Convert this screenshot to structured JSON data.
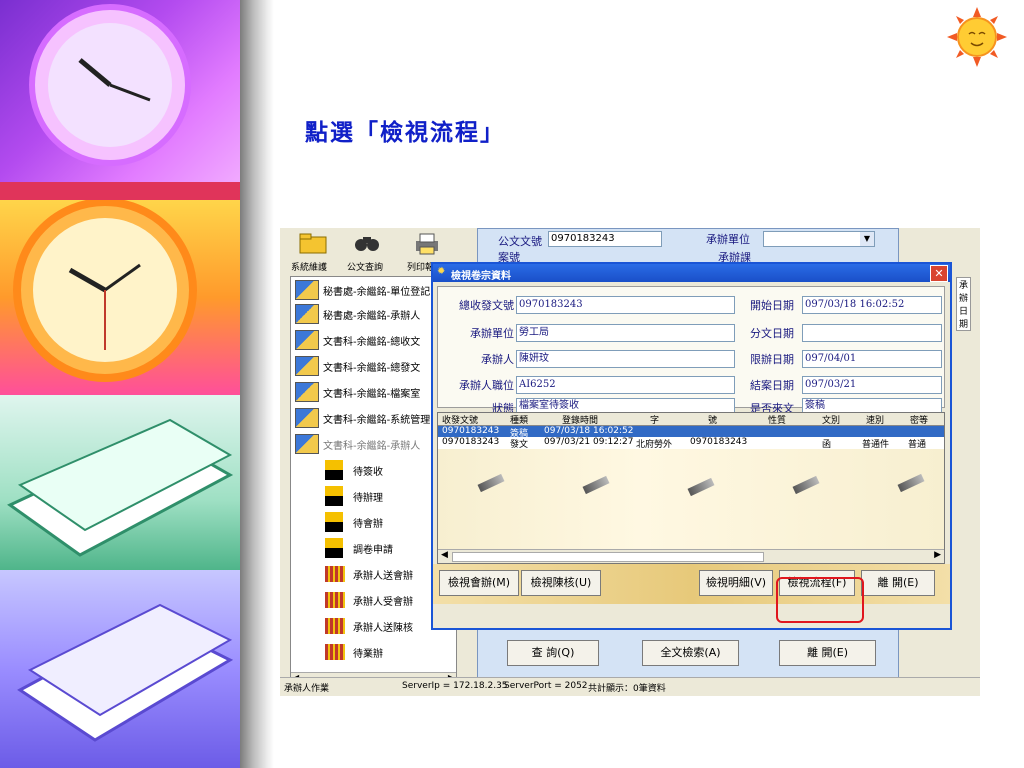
{
  "slide": {
    "title": "點選「檢視流程」"
  },
  "toolbar": {
    "buttons": [
      "系統維護",
      "公文查詢",
      "列印報表"
    ]
  },
  "background_window": {
    "doc_number_label": "公文文號",
    "doc_number_value": "0970183243",
    "unit_label": "承辦單位",
    "second_label": "承辦課",
    "column_label": "承辦日期",
    "second_field_prefix": "案號"
  },
  "tree": {
    "items": [
      "秘書處-余繼銘-單位登記",
      "秘書處-余繼銘-承辦人",
      "文書科-余繼銘-總收文",
      "文書科-余繼銘-總發文",
      "文書科-余繼銘-檔案室",
      "文書科-余繼銘-系統管理",
      "文書科-余繼銘-承辦人"
    ],
    "subitems_fig": [
      "待簽收",
      "待辦理",
      "待會辦",
      "調卷申請"
    ],
    "subitems_bar": [
      "承辦人送會辦",
      "承辦人受會辦",
      "承辦人送陳核",
      "待業辦"
    ]
  },
  "dialog": {
    "title": "檢視卷宗資料",
    "close_glyph": "✕",
    "fields": {
      "doc_no": {
        "label": "總收發文號",
        "value": "0970183243"
      },
      "unit": {
        "label": "承辦單位",
        "value": "勞工局"
      },
      "handler": {
        "label": "承辦人",
        "value": "陳妍玟"
      },
      "position": {
        "label": "承辦人職位",
        "value": "AI6252"
      },
      "status": {
        "label": "狀態",
        "value": "檔案室待簽收"
      },
      "start_date": {
        "label": "開始日期",
        "value": "097/03/18 16:02:52"
      },
      "assign_date": {
        "label": "分文日期",
        "value": ""
      },
      "deadline": {
        "label": "限辦日期",
        "value": "097/04/01"
      },
      "close_date": {
        "label": "結案日期",
        "value": "097/03/21"
      },
      "is_reply": {
        "label": "是否來文",
        "value": "簽稿"
      }
    },
    "grid": {
      "columns": [
        "收發文號",
        "種類",
        "登錄時間",
        "字",
        "號",
        "性質",
        "文別",
        "速別",
        "密等"
      ],
      "rows": [
        [
          "0970183243",
          "簽稿",
          "097/03/18 16:02:52",
          "",
          "",
          "",
          "",
          "",
          ""
        ],
        [
          "0970183243",
          "發文",
          "097/03/21 09:12:27",
          "北府勞外",
          "0970183243",
          "",
          "函",
          "普通件",
          "普通"
        ]
      ]
    },
    "buttons": {
      "co_review": "檢視會辦(M)",
      "submit_review": "檢視陳核(U)",
      "detail": "檢視明細(V)",
      "flow": "檢視流程(F)",
      "leave": "離 開(E)"
    }
  },
  "bottom_buttons": {
    "query": "查 詢(Q)",
    "fulltext": "全文檢索(A)",
    "leave": "離 開(E)"
  },
  "status_bar": {
    "role": "承辦人作業",
    "server_ip": "ServerIp = 172.18.2.35",
    "server_port": "ServerPort = 2052",
    "count": "共計顯示：0筆資料"
  },
  "colors": {
    "title": "#1020c8",
    "highlight": "#e0161e",
    "dialog_title": "#2a6ce6"
  }
}
